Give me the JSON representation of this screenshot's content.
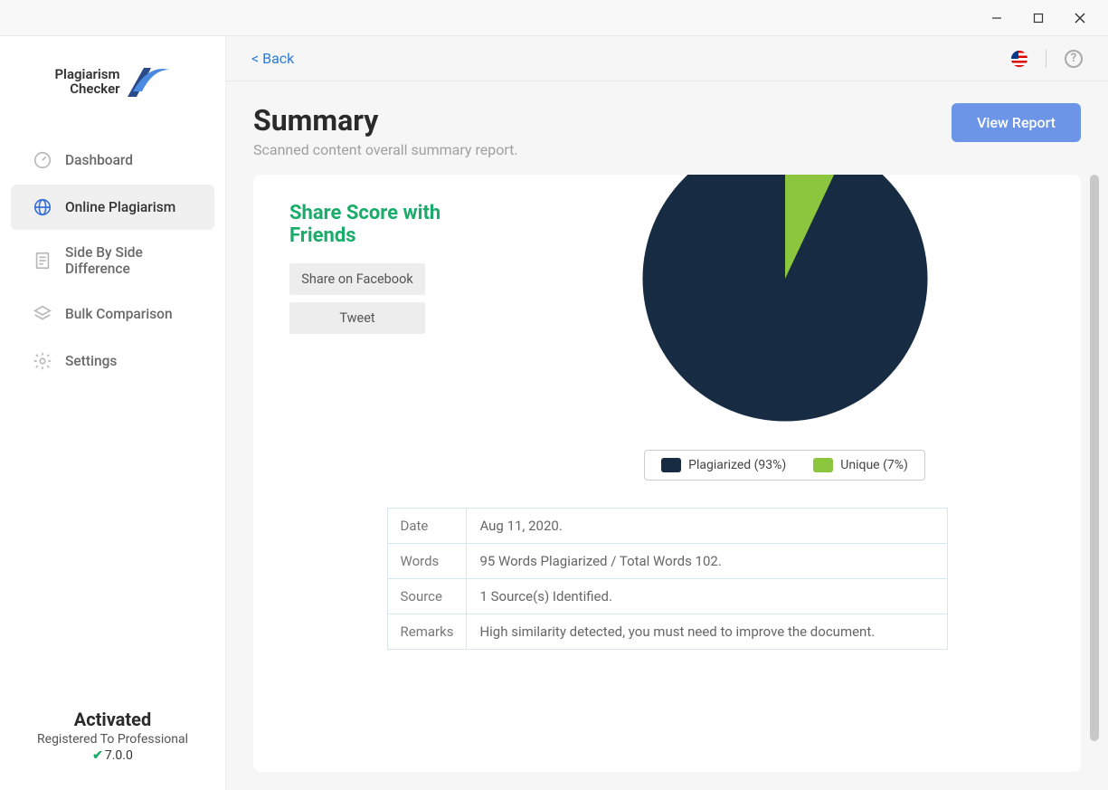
{
  "app": {
    "logo_line1": "Plagiarism",
    "logo_line2": "Checker"
  },
  "sidebar": {
    "items": [
      {
        "label": "Dashboard"
      },
      {
        "label": "Online Plagiarism"
      },
      {
        "label": "Side By Side Difference"
      },
      {
        "label": "Bulk Comparison"
      },
      {
        "label": "Settings"
      }
    ],
    "footer": {
      "activated": "Activated",
      "registered": "Registered To Professional",
      "version": "7.0.0"
    }
  },
  "topbar": {
    "back": "< Back"
  },
  "header": {
    "title": "Summary",
    "subtitle": "Scanned content overall summary report.",
    "button": "View Report"
  },
  "share": {
    "title": "Share Score with Friends",
    "fb": "Share on Facebook",
    "tw": "Tweet"
  },
  "legend": {
    "plag": "Plagiarized (93%)",
    "uniq": "Unique (7%)"
  },
  "table": {
    "rows": [
      {
        "label": "Date",
        "value": "Aug 11, 2020."
      },
      {
        "label": "Words",
        "value": "95 Words Plagiarized / Total Words 102."
      },
      {
        "label": "Source",
        "value": "1 Source(s) Identified."
      },
      {
        "label": "Remarks",
        "value": "High similarity detected, you must need to improve the document."
      }
    ]
  },
  "colors": {
    "plag": "#172b43",
    "uniq": "#8cc63f",
    "accent": "#6c95e8",
    "green": "#1aac6a"
  },
  "chart_data": {
    "type": "pie",
    "title": "",
    "series": [
      {
        "name": "Plagiarized",
        "value": 93,
        "color": "#172b43"
      },
      {
        "name": "Unique",
        "value": 7,
        "color": "#8cc63f"
      }
    ]
  }
}
